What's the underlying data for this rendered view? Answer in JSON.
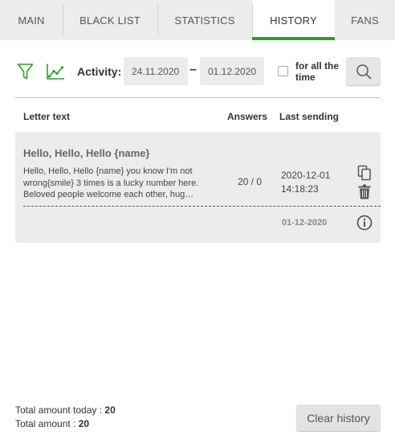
{
  "tabs": [
    {
      "label": "MAIN"
    },
    {
      "label": "BLACK LIST"
    },
    {
      "label": "STATISTICS"
    },
    {
      "label": "HISTORY"
    },
    {
      "label": "FANS"
    }
  ],
  "active_tab": "HISTORY",
  "accent_color": "#2ca02c",
  "filters": {
    "filter_icon": "funnel-icon",
    "chart_icon": "line-chart-icon",
    "activity_label": "Activity:",
    "date_from": "24.11.2020",
    "date_separator": "–",
    "date_to": "01.12.2020",
    "for_all_time_label": "for all the time",
    "for_all_time_checked": false,
    "search_icon": "search-icon"
  },
  "table": {
    "headers": {
      "letter_text": "Letter text",
      "answers": "Answers",
      "last_sending": "Last sending"
    },
    "rows": [
      {
        "title": "Hello, Hello, Hello {name}",
        "text": "Hello, Hello, Hello {name} you know I'm not wrong{smile} 3 times is a lucky number here. Beloved people welcome each other, hug…",
        "answers": "20 / 0",
        "last_sending_date": "2020-12-01",
        "last_sending_time": "14:18:23",
        "date": "01-12-2020",
        "copy_icon": "copy-icon",
        "delete_icon": "trash-icon",
        "info_icon": "info-icon"
      }
    ]
  },
  "footer": {
    "total_today_label": "Total amount today : ",
    "total_today_value": "20",
    "total_label": "Total amount : ",
    "total_value": "20",
    "clear_button": "Clear history"
  }
}
